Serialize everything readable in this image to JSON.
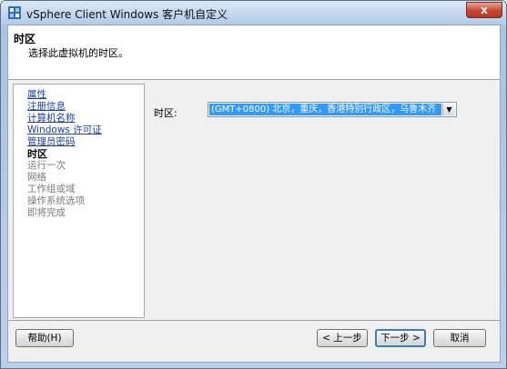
{
  "window": {
    "title": "vSphere Client Windows 客户机自定义",
    "close_symbol": "x"
  },
  "header": {
    "title": "时区",
    "description": "选择此虚拟机的时区。"
  },
  "nav": {
    "items": [
      {
        "label": "属性",
        "state": "link"
      },
      {
        "label": "注册信息",
        "state": "link"
      },
      {
        "label": "计算机名称",
        "state": "link"
      },
      {
        "label": "Windows 许可证",
        "state": "link"
      },
      {
        "label": "管理员密码",
        "state": "link"
      },
      {
        "label": "时区",
        "state": "current"
      },
      {
        "label": "运行一次",
        "state": "disabled"
      },
      {
        "label": "网络",
        "state": "disabled"
      },
      {
        "label": "工作组或域",
        "state": "disabled"
      },
      {
        "label": "操作系统选项",
        "state": "disabled"
      },
      {
        "label": "即将完成",
        "state": "disabled"
      }
    ]
  },
  "timezone": {
    "label": "时区:",
    "selected": "(GMT+0800) 北京，重庆，香港特别行政区，乌鲁木齐"
  },
  "buttons": {
    "help": "帮助(H)",
    "back": "< 上一步",
    "next": "下一步 >",
    "cancel": "取消"
  },
  "colors": {
    "link": "#1a3fb0",
    "selection": "#3399ff",
    "close": "#c6452f"
  }
}
